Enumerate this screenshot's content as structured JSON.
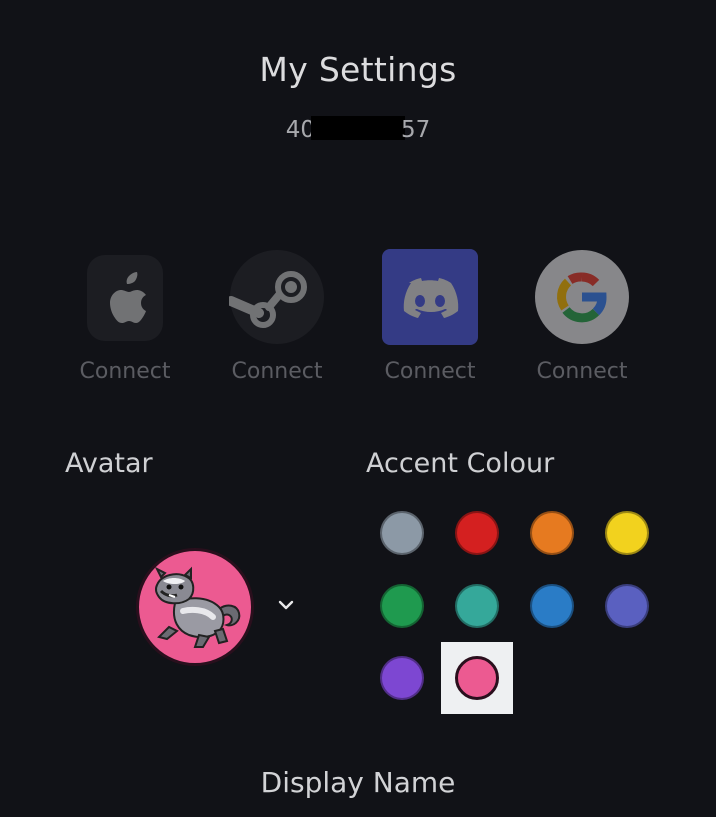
{
  "header": {
    "title": "My Settings",
    "user_id_prefix": "40",
    "user_id_suffix": "57"
  },
  "connections": [
    {
      "service": "apple",
      "icon": "apple-icon",
      "label": "Connect"
    },
    {
      "service": "steam",
      "icon": "steam-icon",
      "label": "Connect"
    },
    {
      "service": "discord",
      "icon": "discord-icon",
      "label": "Connect"
    },
    {
      "service": "google",
      "icon": "google-icon",
      "label": "Connect"
    }
  ],
  "avatar": {
    "section_title": "Avatar",
    "background": "#ec5a91",
    "icon": "raccoon-avatar-icon",
    "dropdown_icon": "chevron-down-icon"
  },
  "accent": {
    "section_title": "Accent Colour",
    "selected_index": 9,
    "colors": [
      "#8c99a6",
      "#d42020",
      "#e67a20",
      "#f2d21e",
      "#1f9a4f",
      "#35a89a",
      "#2a7cc6",
      "#5a60c0",
      "#7d47d2",
      "#ec5a91"
    ]
  },
  "display_name": {
    "label": "Display Name"
  }
}
